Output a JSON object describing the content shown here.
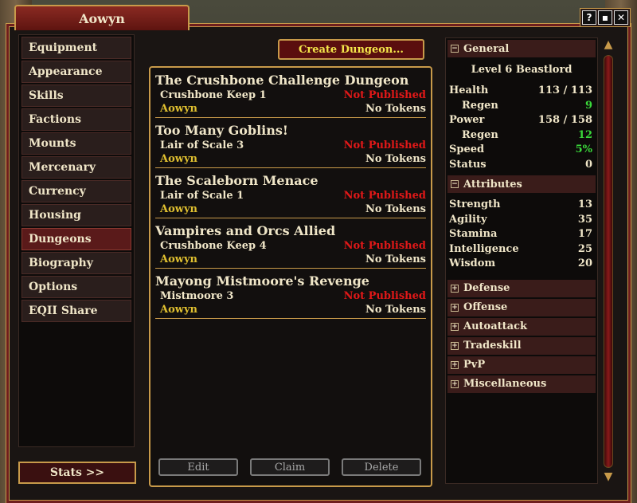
{
  "window": {
    "title": "Aowyn"
  },
  "controls": {
    "help": "?",
    "min": "▪",
    "close": "✕"
  },
  "nav": {
    "items": [
      "Equipment",
      "Appearance",
      "Skills",
      "Factions",
      "Mounts",
      "Mercenary",
      "Currency",
      "Housing",
      "Dungeons",
      "Biography",
      "Options",
      "EQII Share"
    ],
    "active": "Dungeons",
    "stats_button": "Stats >>"
  },
  "dungeons": {
    "create_label": "Create Dungeon...",
    "list": [
      {
        "name": "The Crushbone Challenge Dungeon",
        "zone": "Crushbone Keep 1",
        "status": "Not Published",
        "owner": "Aowyn",
        "tokens": "No Tokens"
      },
      {
        "name": "Too Many Goblins!",
        "zone": "Lair of Scale 3",
        "status": "Not Published",
        "owner": "Aowyn",
        "tokens": "No Tokens"
      },
      {
        "name": "The Scaleborn Menace",
        "zone": "Lair of Scale 1",
        "status": "Not Published",
        "owner": "Aowyn",
        "tokens": "No Tokens"
      },
      {
        "name": "Vampires and Orcs Allied",
        "zone": "Crushbone Keep 4",
        "status": "Not Published",
        "owner": "Aowyn",
        "tokens": "No Tokens"
      },
      {
        "name": "Mayong Mistmoore's Revenge",
        "zone": "Mistmoore 3",
        "status": "Not Published",
        "owner": "Aowyn",
        "tokens": "No Tokens"
      }
    ],
    "edit_label": "Edit",
    "claim_label": "Claim",
    "delete_label": "Delete"
  },
  "stats": {
    "general_label": "General",
    "level": "Level 6 Beastlord",
    "general": [
      {
        "label": "Health",
        "value": "113 / 113",
        "sub": false,
        "green": false
      },
      {
        "label": "Regen",
        "value": "9",
        "sub": true,
        "green": true
      },
      {
        "label": "Power",
        "value": "158 / 158",
        "sub": false,
        "green": false
      },
      {
        "label": "Regen",
        "value": "12",
        "sub": true,
        "green": true
      },
      {
        "label": "Speed",
        "value": "5%",
        "sub": false,
        "green": true
      },
      {
        "label": "Status",
        "value": "0",
        "sub": false,
        "green": false
      }
    ],
    "attributes_label": "Attributes",
    "attributes": [
      {
        "label": "Strength",
        "value": "13"
      },
      {
        "label": "Agility",
        "value": "35"
      },
      {
        "label": "Stamina",
        "value": "17"
      },
      {
        "label": "Intelligence",
        "value": "25"
      },
      {
        "label": "Wisdom",
        "value": "20"
      }
    ],
    "collapsed": [
      "Defense",
      "Offense",
      "Autoattack",
      "Tradeskill",
      "PvP",
      "Miscellaneous"
    ],
    "expanded_toggle": "−",
    "collapsed_toggle": "+"
  }
}
